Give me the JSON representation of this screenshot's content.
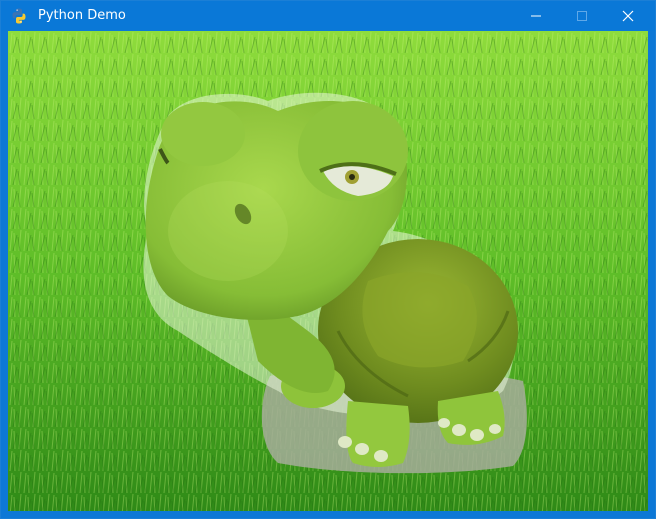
{
  "window": {
    "title": "Python Demo",
    "app_icon": "python-icon",
    "controls": {
      "minimize_icon": "minimize-icon",
      "maximize_icon": "maximize-icon",
      "close_icon": "close-icon"
    }
  },
  "colors": {
    "titlebar": "#0a78d7",
    "title_text": "#ffffff",
    "grass_light": "#8fdc3c",
    "grass_dark": "#2f8a17",
    "turtle_skin": "#8cc43a",
    "turtle_shell": "#6e8f1e"
  }
}
